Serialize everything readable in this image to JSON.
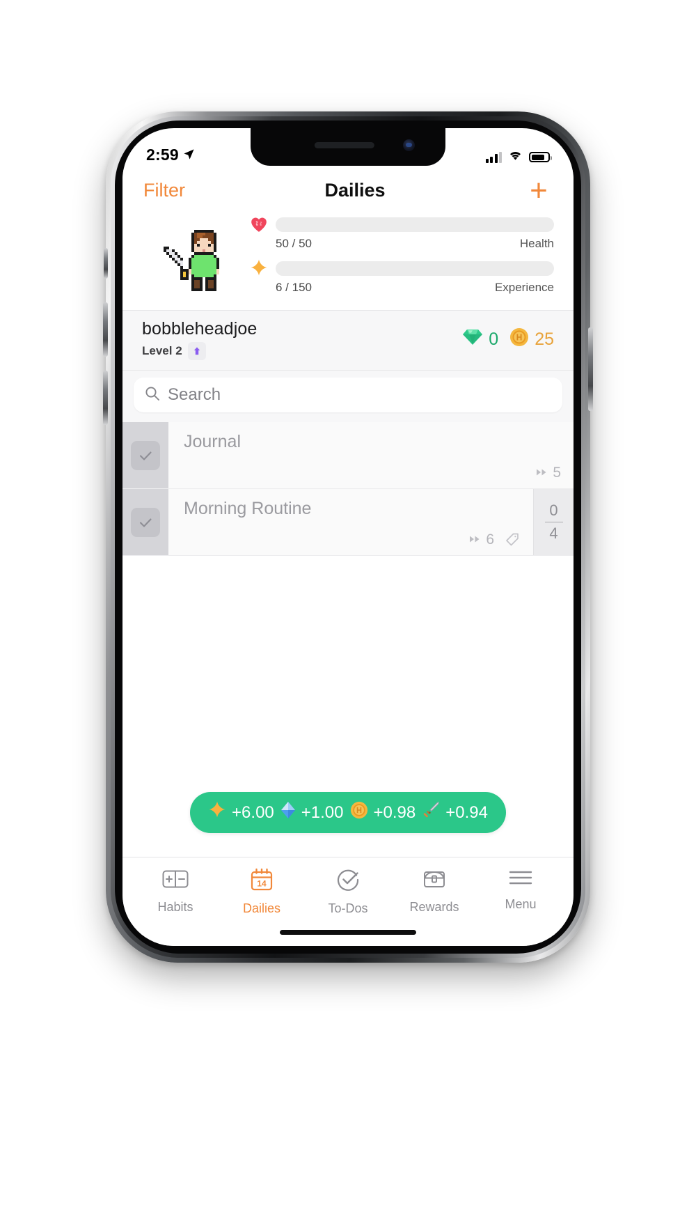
{
  "statusbar": {
    "time": "2:59",
    "location_icon": "location-arrow-icon",
    "signal_icon": "cellular-signal-icon",
    "wifi_icon": "wifi-icon",
    "battery_icon": "battery-icon"
  },
  "navbar": {
    "filter_label": "Filter",
    "title": "Dailies",
    "add_label": "+"
  },
  "hero": {
    "avatar_name": "pixel-warrior-avatar",
    "health": {
      "icon": "heart-icon",
      "value_text": "50 / 50",
      "label": "Health",
      "current": 50,
      "max": 50,
      "percent": 100,
      "color": "#fb5d5d"
    },
    "experience": {
      "icon": "star-sparkle-icon",
      "value_text": "6 / 150",
      "label": "Experience",
      "current": 6,
      "max": 150,
      "percent": 4,
      "color": "#f5b350"
    }
  },
  "userbar": {
    "username": "bobbleheadjoe",
    "level_label": "Level 2",
    "level_badge_icon": "level-up-arrow-icon",
    "gems": {
      "icon": "gem-icon",
      "value": "0",
      "color": "#1aa86a"
    },
    "gold": {
      "icon": "gold-coin-icon",
      "value": "25",
      "color": "#e8a33b"
    }
  },
  "search": {
    "icon": "search-icon",
    "placeholder": "Search",
    "value": ""
  },
  "tasks": [
    {
      "title": "Journal",
      "checked": true,
      "streak_icon": "streak-forward-icon",
      "streak": "5",
      "has_tag": false,
      "tag_icon": "",
      "has_counter": false,
      "counter_top": "",
      "counter_bottom": ""
    },
    {
      "title": "Morning Routine",
      "checked": true,
      "streak_icon": "streak-forward-icon",
      "streak": "6",
      "has_tag": true,
      "tag_icon": "tag-icon",
      "has_counter": true,
      "counter_top": "0",
      "counter_bottom": "4"
    }
  ],
  "toast": {
    "background": "#2bc789",
    "items": [
      {
        "icon": "star-sparkle-icon",
        "value": "+6.00"
      },
      {
        "icon": "blue-gem-icon",
        "value": "+1.00"
      },
      {
        "icon": "gold-coin-icon",
        "value": "+0.98"
      },
      {
        "icon": "sword-icon",
        "value": "+0.94"
      }
    ]
  },
  "tabbar": {
    "active_color": "#f1883a",
    "inactive_color": "#8d8d92",
    "tabs": [
      {
        "label": "Habits",
        "icon": "plus-minus-icon",
        "active": false
      },
      {
        "label": "Dailies",
        "icon": "calendar-14-icon",
        "active": true
      },
      {
        "label": "To-Dos",
        "icon": "check-circle-icon",
        "active": false
      },
      {
        "label": "Rewards",
        "icon": "treasure-chest-icon",
        "active": false
      },
      {
        "label": "Menu",
        "icon": "hamburger-icon",
        "active": false
      }
    ]
  }
}
